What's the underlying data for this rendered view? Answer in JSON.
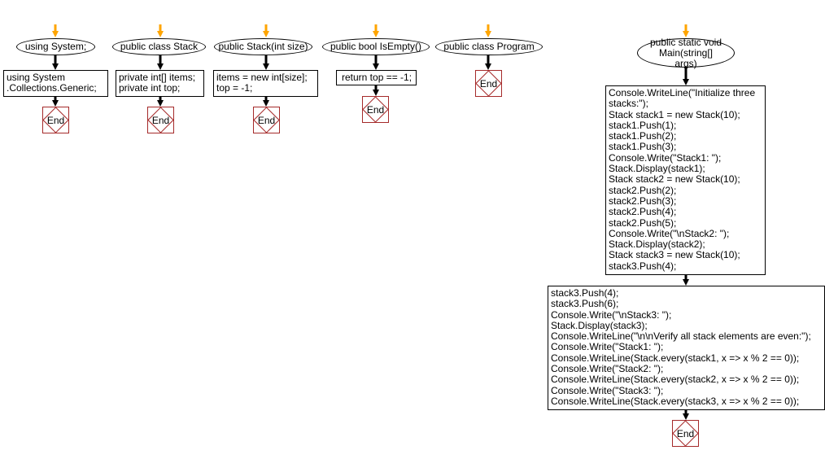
{
  "colors": {
    "start_arrow": "#ffa500",
    "end_border": "#a52a2a",
    "line": "#000000"
  },
  "end_label": "End",
  "flows": [
    {
      "start": "using System;",
      "body": [
        "using System",
        ".Collections.Generic;"
      ]
    },
    {
      "start": "public class Stack",
      "body": [
        "private int[] items;",
        "private int top;"
      ]
    },
    {
      "start": "public Stack(int size)",
      "body": [
        "items = new int[size];",
        "top = -1;"
      ]
    },
    {
      "start": "public bool IsEmpty()",
      "body": [
        "return top == -1;"
      ]
    },
    {
      "start": "public class Program",
      "body": []
    },
    {
      "start": "public static void Main(string[] args)",
      "body": [
        "Console.WriteLine(\"Initialize three",
        "stacks:\");",
        "Stack stack1 = new Stack(10);",
        "stack1.Push(1);",
        "stack1.Push(2);",
        "stack1.Push(3);",
        "Console.Write(\"Stack1: \");",
        "Stack.Display(stack1);",
        "Stack stack2 = new Stack(10);",
        "stack2.Push(2);",
        "stack2.Push(3);",
        "stack2.Push(4);",
        "stack2.Push(5);",
        "Console.Write(\"\\nStack2: \");",
        "Stack.Display(stack2);",
        "Stack stack3 = new Stack(10);",
        "stack3.Push(4);"
      ],
      "body2": [
        "stack3.Push(4);",
        "stack3.Push(6);",
        "Console.Write(\"\\nStack3: \");",
        "Stack.Display(stack3);",
        "Console.WriteLine(\"\\n\\nVerify all stack elements are even:\");",
        "Console.Write(\"Stack1: \");",
        "Console.WriteLine(Stack.every(stack1, x => x % 2 == 0));",
        "Console.Write(\"Stack2: \");",
        "Console.WriteLine(Stack.every(stack2, x => x % 2 == 0));",
        "Console.Write(\"Stack3: \");",
        "Console.WriteLine(Stack.every(stack3, x => x % 2 == 0));"
      ]
    }
  ]
}
